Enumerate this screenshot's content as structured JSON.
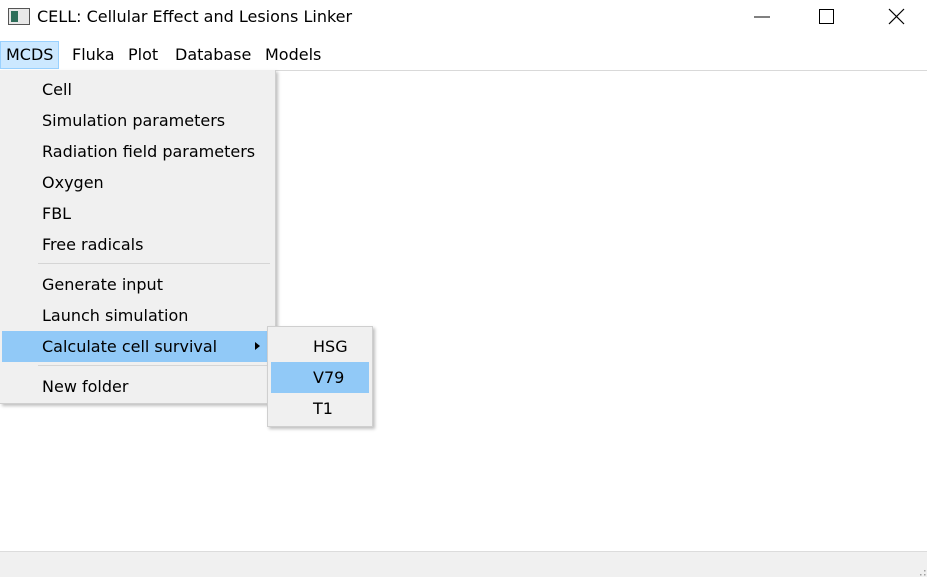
{
  "window": {
    "title": "CELL: Cellular Effect and Lesions Linker",
    "app_icon": "app-window-icon",
    "controls": [
      "minimize-icon",
      "maximize-icon",
      "close-icon"
    ]
  },
  "menubar": {
    "items": [
      "MCDS",
      "Fluka",
      "Plot",
      "Database",
      "Models"
    ],
    "active": "MCDS"
  },
  "dropdown": {
    "group1": [
      "Cell",
      "Simulation parameters",
      "Radiation field parameters",
      "Oxygen",
      "FBL",
      "Free radicals"
    ],
    "group2": [
      "Generate input",
      "Launch simulation",
      "Calculate cell survival"
    ],
    "group3": [
      "New folder"
    ],
    "highlighted": "Calculate cell survival",
    "submenu_arrow_icon": "chevron-right-icon"
  },
  "submenu": {
    "items": [
      "HSG",
      "V79",
      "T1"
    ],
    "highlighted": "V79"
  },
  "colors": {
    "menu_active_bg": "#cce8ff",
    "highlight_bg": "#91c9f7",
    "menu_bg": "#f0f0f0"
  }
}
